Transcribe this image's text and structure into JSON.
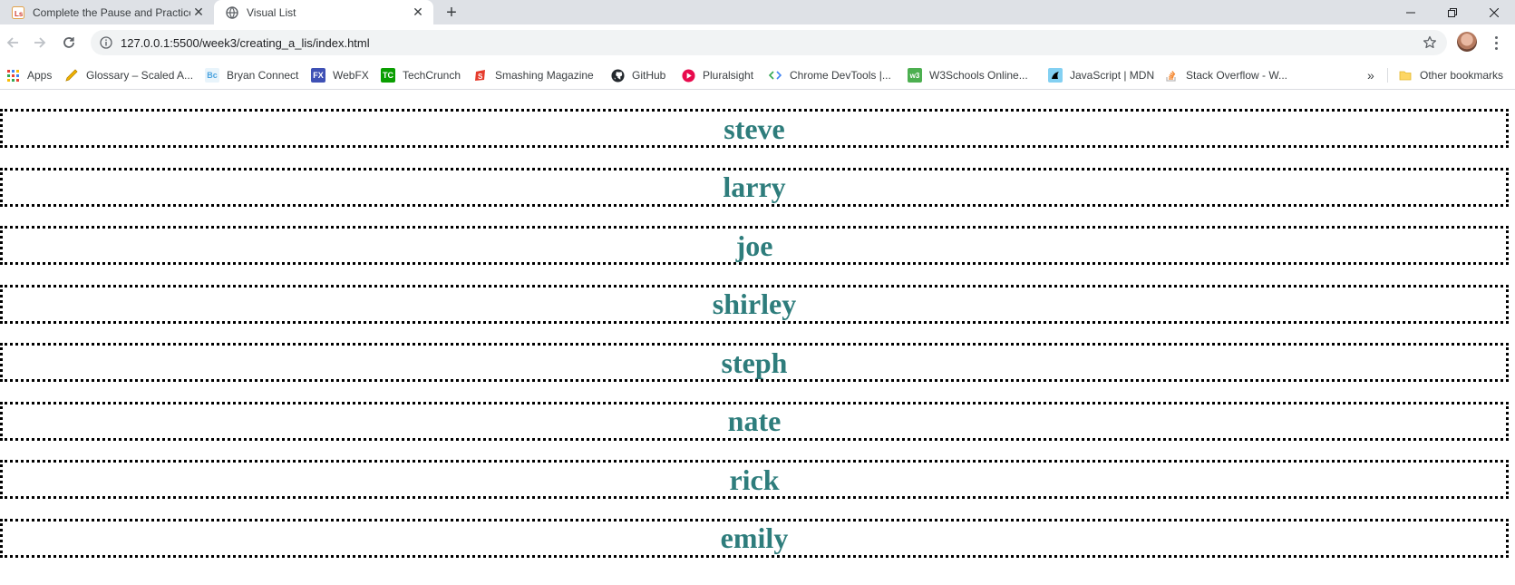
{
  "browser": {
    "tabs": [
      {
        "title": "Complete the Pause and Practice",
        "favicon": "lambda-school-icon",
        "active": false
      },
      {
        "title": "Visual List",
        "favicon": "globe-icon",
        "active": true
      }
    ],
    "url": "127.0.0.1:5500/week3/creating_a_lis/index.html"
  },
  "bookmarks": {
    "items": [
      {
        "label": "Apps",
        "icon": "apps-grid-icon",
        "color": "#e8453c"
      },
      {
        "label": "Glossary – Scaled A...",
        "icon": "pencil-icon",
        "color": "#f4b400"
      },
      {
        "label": "Bryan Connect",
        "icon": "bc-icon",
        "color": "#4aa3df"
      },
      {
        "label": "WebFX",
        "icon": "fx-icon",
        "color": "#3f51b5"
      },
      {
        "label": "TechCrunch",
        "icon": "tc-icon",
        "color": "#0a9e01"
      },
      {
        "label": "Smashing Magazine",
        "icon": "smashing-icon",
        "color": "#e53b2c"
      },
      {
        "label": "GitHub",
        "icon": "github-icon",
        "color": "#24292e"
      },
      {
        "label": "Pluralsight",
        "icon": "pluralsight-icon",
        "color": "#e80a4d"
      },
      {
        "label": "Chrome DevTools |...",
        "icon": "devtools-icon",
        "color": "#4285f4"
      },
      {
        "label": "W3Schools Online...",
        "icon": "w3schools-icon",
        "color": "#4caf50"
      },
      {
        "label": "JavaScript | MDN",
        "icon": "mdn-icon",
        "color": "#83d0f2"
      },
      {
        "label": "Stack Overflow - W...",
        "icon": "stackoverflow-icon",
        "color": "#f48024"
      }
    ],
    "overflow": "»",
    "other_label": "Other bookmarks"
  },
  "list": {
    "color": "#2e7d7c",
    "items": [
      "steve",
      "larry",
      "joe",
      "shirley",
      "steph",
      "nate",
      "rick",
      "emily"
    ]
  }
}
